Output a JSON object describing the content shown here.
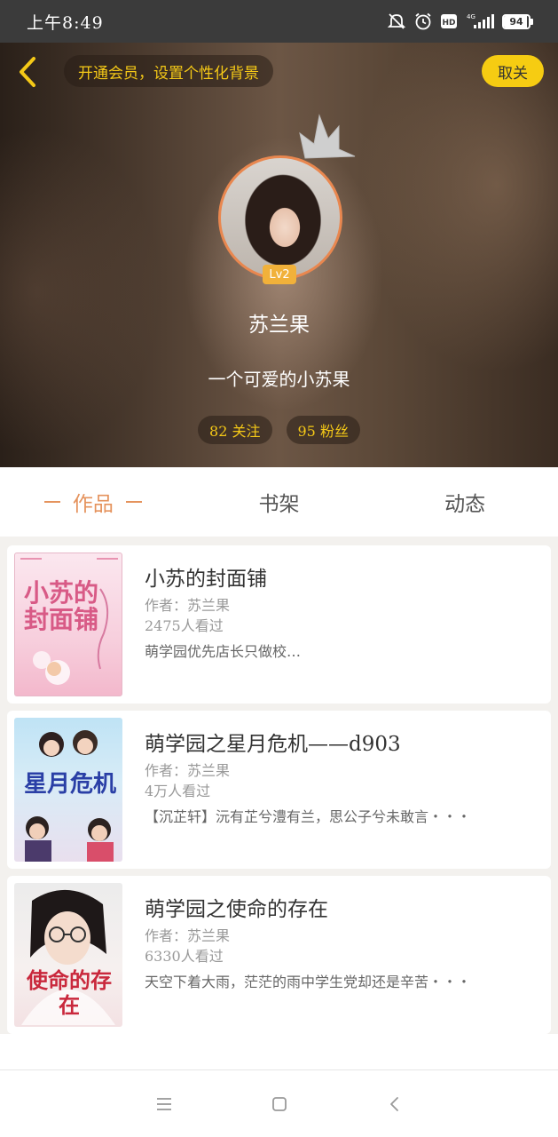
{
  "status_bar": {
    "time": "上午8:49",
    "network": "4G",
    "battery": "94"
  },
  "header": {
    "vip_banner": "开通会员，设置个性化背景",
    "unfollow_label": "取关",
    "level": "Lv2",
    "username": "苏兰果",
    "bio": "一个可爱的小苏果",
    "following": "82 关注",
    "followers": "95 粉丝"
  },
  "tabs": [
    {
      "label": "作品",
      "active": true
    },
    {
      "label": "书架",
      "active": false
    },
    {
      "label": "动态",
      "active": false
    }
  ],
  "books": [
    {
      "title": "小苏的封面铺",
      "author": "作者：苏兰果",
      "views": "2475人看过",
      "desc": "萌学园优先店长只做校…",
      "cover_text": "小苏的封面铺"
    },
    {
      "title": "萌学园之星月危机——d903",
      "author": "作者：苏兰果",
      "views": "4万人看过",
      "desc": "【沉芷轩】沅有芷兮澧有兰，思公子兮未敢言・・・",
      "cover_text": "星月危机"
    },
    {
      "title": "萌学园之使命的存在",
      "author": "作者：苏兰果",
      "views": "6330人看过",
      "desc": "天空下着大雨，茫茫的雨中学生党却还是辛苦・・・",
      "cover_text": "使命的存在"
    }
  ],
  "colors": {
    "accent": "#e5935d",
    "gold": "#f5c917",
    "unfollow_bg": "#f6cc12"
  }
}
